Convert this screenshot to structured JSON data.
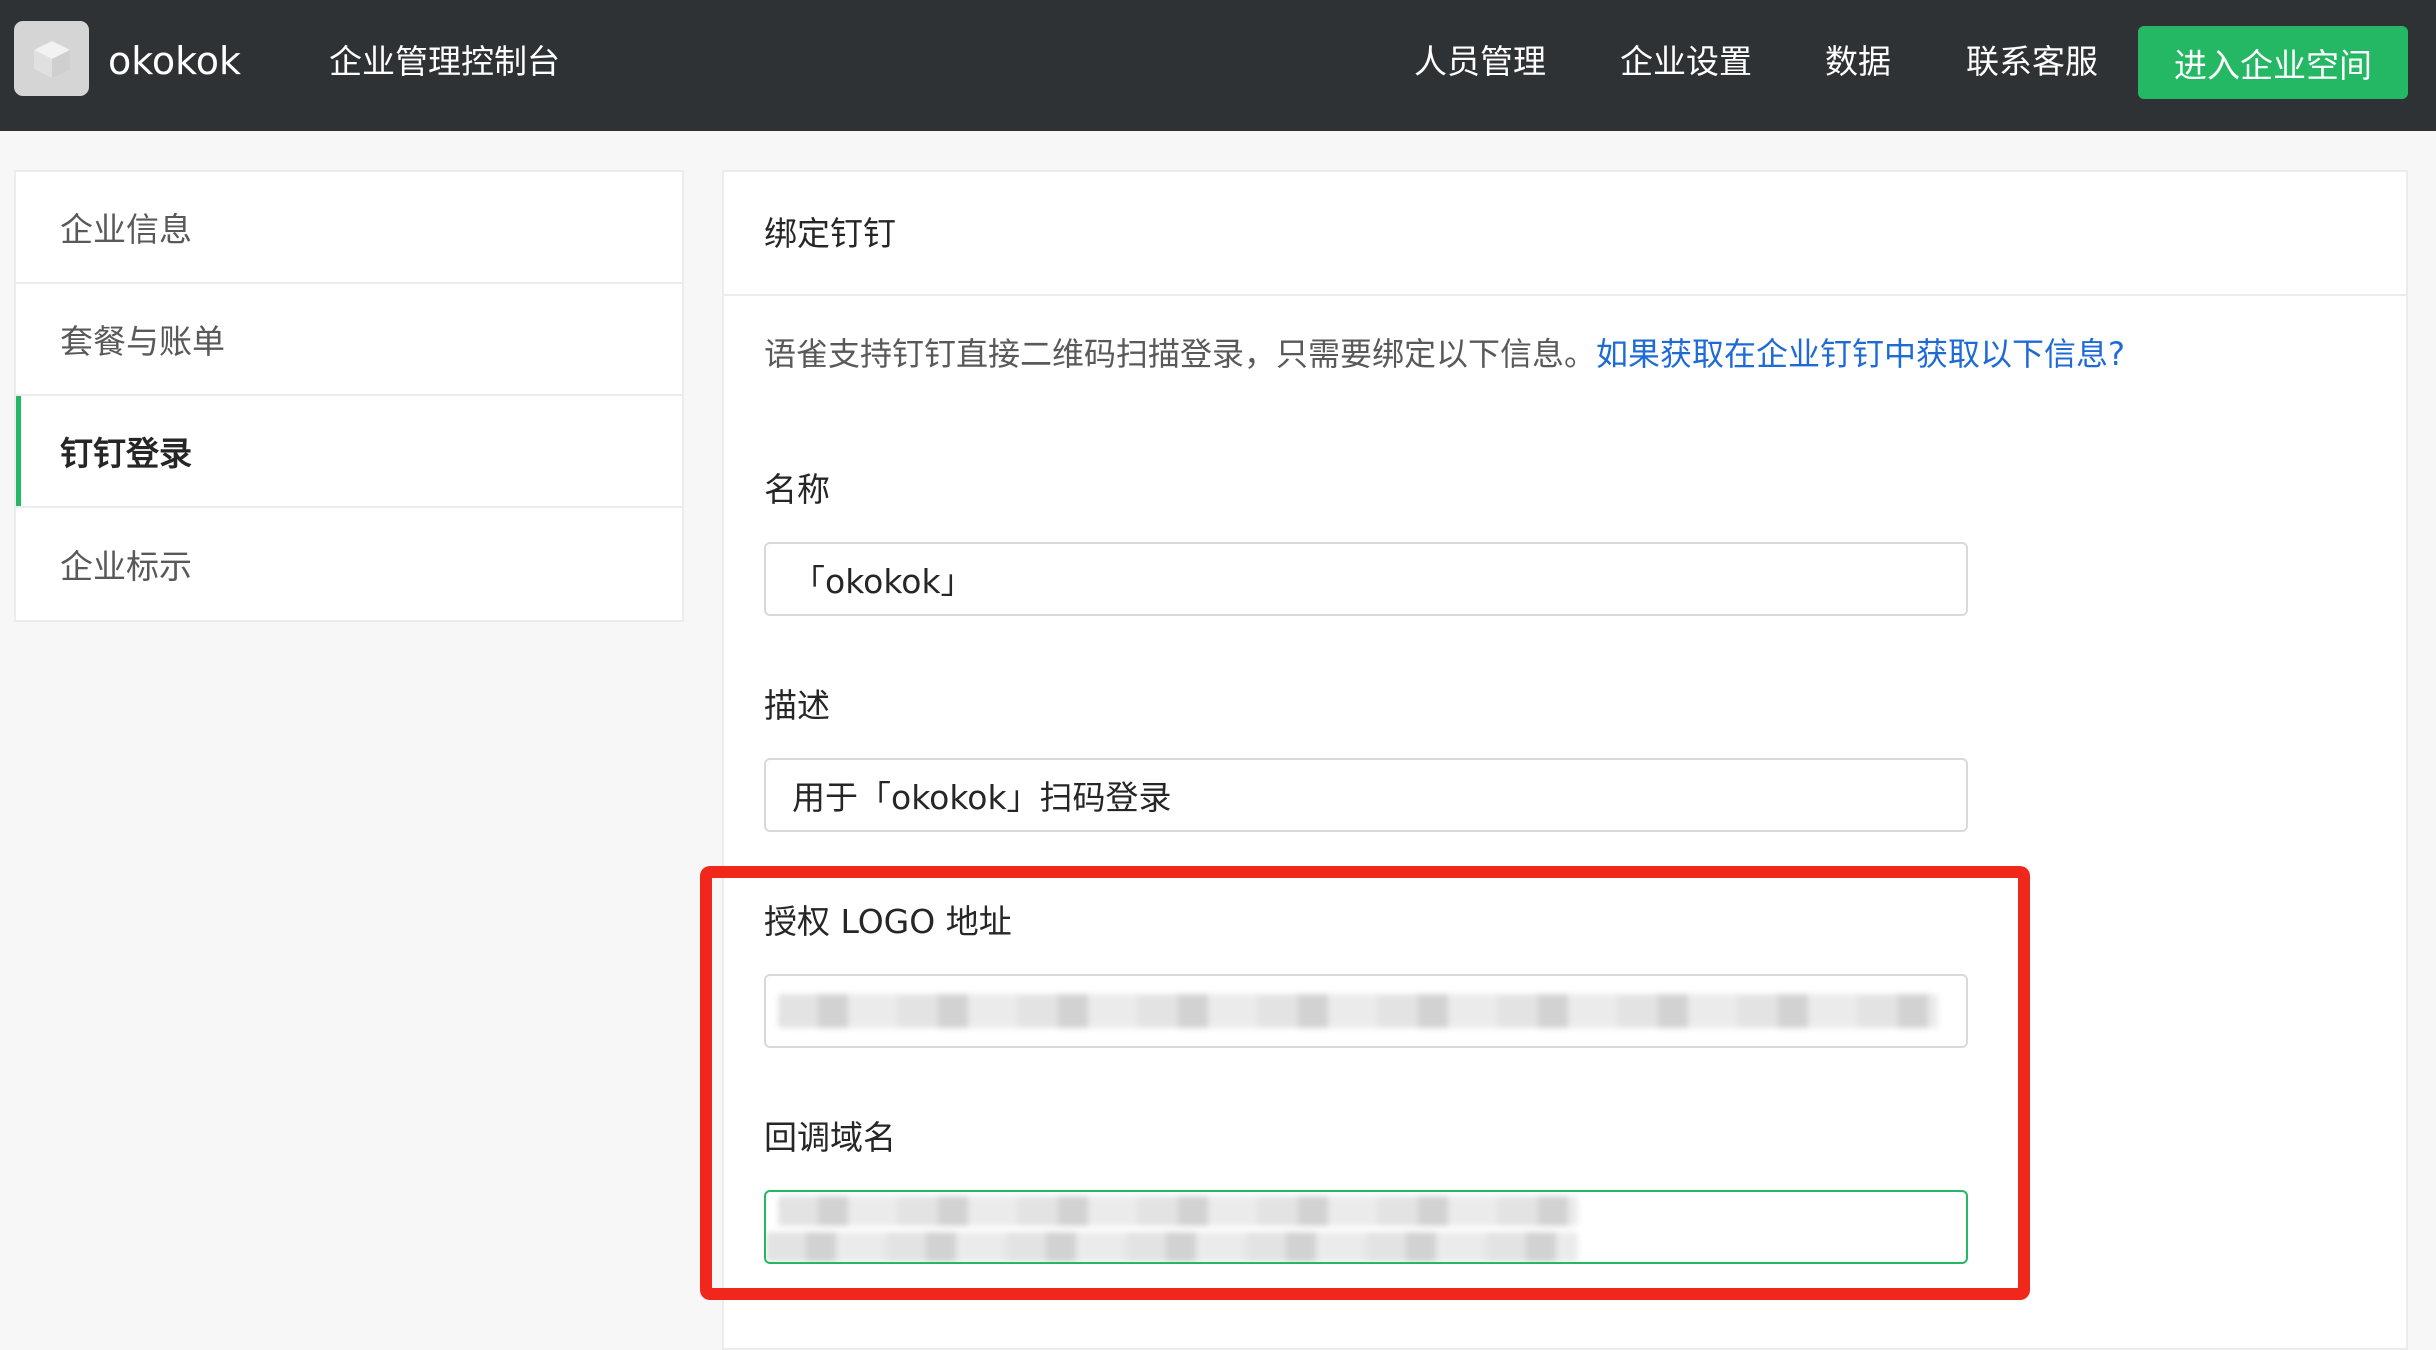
{
  "header": {
    "brand": "okokok",
    "console_title": "企业管理控制台",
    "nav": {
      "people": "人员管理",
      "settings": "企业设置",
      "data": "数据",
      "support": "联系客服"
    },
    "enter_button": "进入企业空间"
  },
  "sidebar": {
    "items": [
      {
        "label": "企业信息",
        "active": false
      },
      {
        "label": "套餐与账单",
        "active": false
      },
      {
        "label": "钉钉登录",
        "active": true
      },
      {
        "label": "企业标示",
        "active": false
      }
    ]
  },
  "panel": {
    "title": "绑定钉钉",
    "intro_text": "语雀支持钉钉直接二维码扫描登录，只需要绑定以下信息。",
    "intro_link": "如果获取在企业钉钉中获取以下信息?",
    "fields": {
      "name_label": "名称",
      "name_value": "「okokok」",
      "desc_label": "描述",
      "desc_value": "用于「okokok」扫码登录",
      "logo_label": "授权 LOGO 地址",
      "callback_label": "回调域名"
    }
  },
  "colors": {
    "topbar": "#2f3235",
    "accent_green": "#25b864",
    "link_blue": "#1f6bd6",
    "highlight_red": "#f2271c"
  }
}
